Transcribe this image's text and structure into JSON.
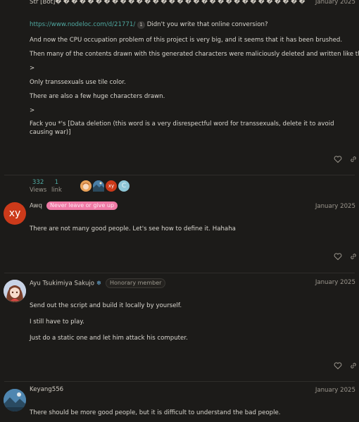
{
  "post1": {
    "username": "Str [Bot]� � � � � � � � � � � � � � � � � � � � � � � � � � � �  � �  �",
    "date": "January 2025",
    "link_url": "https://www.nodeloc.com/d/21771/",
    "link_count": "1",
    "line1_text": "Didn't you write that online conversion?",
    "line2": "And now the CPU occupation problem of this project is very big, and it seems that it has been brushed.",
    "line3": "Then many of the contents drawn with this generated characters were maliciously deleted and written like this:",
    "quote1": ">",
    "line4": "Only transsexuals use tile color.",
    "line5": "There are also a few huge characters drawn.",
    "quote2": ">",
    "line6": "Fack you *'s [Data deletion (this word is a very disrespectful word for transsexuals, delete it to avoid causing war)]"
  },
  "topic_stats": {
    "views_count": "332",
    "views_label": "Views",
    "link_count": "1",
    "link_label": "link",
    "participants": [
      {
        "initials": "",
        "color": "#d68a3c",
        "icon": "anime-avatar"
      },
      {
        "initials": "",
        "color": "#3f6f8f",
        "icon": "landscape-avatar"
      },
      {
        "initials": "xy",
        "color": "#cc3a1a",
        "icon": "initials-avatar"
      },
      {
        "initials": "C",
        "color": "#8ec6d6",
        "icon": "initials-avatar"
      }
    ]
  },
  "post2": {
    "avatar_initials": "xy",
    "avatar_color": "#cc3a1a",
    "username": "Awq",
    "flair": "Never leave or give up",
    "date": "January 2025",
    "body": "There are not many good people. Let's see how to define it. Hahaha"
  },
  "post3": {
    "username": "Ayu Tsukimiya Sakujo",
    "snowflake": "❄",
    "flair": "Honorary member",
    "date": "January 2025",
    "line1": "Send out the script and build it locally by yourself.",
    "line2": "I still have to play.",
    "line3": "Just do a static one and let him attack his computer."
  },
  "post4": {
    "username": "Keyang556",
    "date": "January 2025",
    "body": "There should be more good people, but it is difficult to understand the bad people."
  }
}
